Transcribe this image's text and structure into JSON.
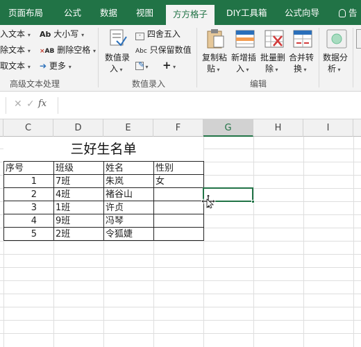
{
  "ribbon_tabs": [
    {
      "label": "页面布局"
    },
    {
      "label": "公式"
    },
    {
      "label": "数据"
    },
    {
      "label": "视图"
    },
    {
      "label": "方方格子",
      "active": true
    },
    {
      "label": "DIY工具箱"
    },
    {
      "label": "公式向导"
    },
    {
      "label": "告"
    }
  ],
  "groups": {
    "advanced_text": {
      "label": "高级文本处理",
      "items": [
        "入文本",
        "除文本",
        "取文本"
      ],
      "case_label": "大小写",
      "delete_space_label": "删除空格",
      "more_label": "更多"
    },
    "value_entry": {
      "label": "数值录入",
      "value_entry_btn": "数值录入",
      "round_label": "四舍五入",
      "keep_value_label": "只保留数值",
      "plus_label": "+"
    },
    "edit": {
      "label": "编辑",
      "copy_paste": "复制粘贴",
      "insert_new": "新增插入",
      "batch_delete": "批量删除",
      "merge_convert": "合并转换",
      "data_analysis": "数据分析"
    }
  },
  "formula_bar": {
    "cancel_glyph": "✓",
    "fx_label": "fx",
    "value": ""
  },
  "columns": [
    "C",
    "D",
    "E",
    "F",
    "G",
    "H",
    "I"
  ],
  "selected_column": "G",
  "sheet_title": "三好生名单",
  "table": {
    "headers": [
      "序号",
      "班级",
      "姓名",
      "性别"
    ],
    "rows": [
      [
        "1",
        "7班",
        "朱岚",
        "女"
      ],
      [
        "2",
        "4班",
        "褚谷山",
        ""
      ],
      [
        "3",
        "1班",
        "许贞",
        ""
      ],
      [
        "4",
        "9班",
        "冯琴",
        ""
      ],
      [
        "5",
        "2班",
        "令狐婕",
        ""
      ]
    ]
  },
  "colors": {
    "brand": "#217346",
    "ribbon_bg": "#f3f3f3"
  }
}
